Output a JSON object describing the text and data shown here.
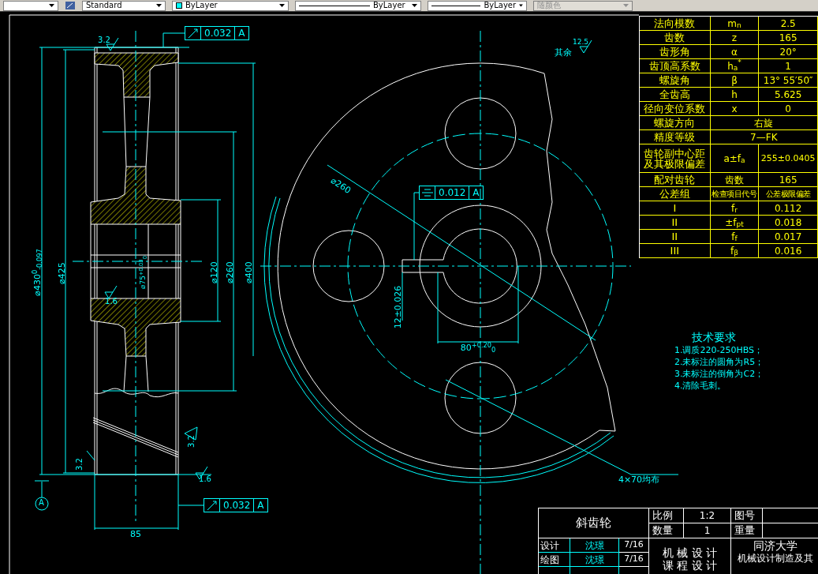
{
  "toolbar": {
    "dropdowns": [
      {
        "kind": "text",
        "text": "Standard",
        "disabled": false
      },
      {
        "kind": "color",
        "text": "ByLayer",
        "disabled": false
      },
      {
        "kind": "line",
        "text": "ByLayer",
        "disabled": false
      },
      {
        "kind": "line",
        "text": "ByLayer",
        "disabled": false
      },
      {
        "kind": "text",
        "text": "随颜色",
        "disabled": true
      }
    ]
  },
  "section_view": {
    "labels": [
      "3.2",
      "⌀430$^{0}$$_{-0.097}$",
      "⌀425",
      "⌀75$^{+0.03}$$_{0}$",
      "⌀120",
      "⌀260",
      "⌀400",
      "1.6",
      "3.2",
      "3.2",
      "1.6",
      "85"
    ],
    "tolerance_frames": [
      {
        "kind": "runout",
        "value": "0.032",
        "datum": "A"
      },
      {
        "kind": "runout",
        "value": "0.032",
        "datum": "A"
      }
    ],
    "datum": "A"
  },
  "front_view": {
    "labels": [
      "其余",
      "12.5",
      "⌀260",
      "12±0.026",
      "80$^{+0.20}$$_{0}$",
      "4×70均布"
    ],
    "tolerance_frames": [
      {
        "kind": "symmetry",
        "value": "0.012",
        "datum": "A"
      }
    ]
  },
  "parameter_table": {
    "rows": [
      {
        "kind": "param",
        "name": "法向模数",
        "symbol": "m$_{n}$",
        "value": "2.5"
      },
      {
        "kind": "param",
        "name": "齿数",
        "symbol": "z",
        "value": "165"
      },
      {
        "kind": "param",
        "name": "齿形角",
        "symbol": "α",
        "value": "20°"
      },
      {
        "kind": "param",
        "name": "齿顶高系数",
        "symbol": "h$_{a}$$^{*}$",
        "value": "1"
      },
      {
        "kind": "param",
        "name": "螺旋角",
        "symbol": "β",
        "value": "13° 55′50″"
      },
      {
        "kind": "param",
        "name": "全齿高",
        "symbol": "h",
        "value": "5.625"
      },
      {
        "kind": "param",
        "name": "径向变位系数",
        "symbol": "x",
        "value": "0"
      },
      {
        "kind": "merged",
        "name": "螺旋方向",
        "value": "右旋"
      },
      {
        "kind": "merged",
        "name": "精度等级",
        "value": "7—FK"
      },
      {
        "kind": "tall",
        "name": "齿轮副中心距及其极限偏差",
        "symbol": "a±f$_{a}$",
        "value": "255±0.0405"
      },
      {
        "kind": "param",
        "name": "配对齿轮",
        "symbol": "齿数",
        "value": "165"
      },
      {
        "kind": "header",
        "name": "公差组",
        "symbol": "检查项目代号",
        "value": "公差极限偏差"
      },
      {
        "kind": "param",
        "name": "I",
        "symbol": "f$_{r}$",
        "value": "0.112"
      },
      {
        "kind": "param",
        "name": "II",
        "symbol": "±f$_{pt}$",
        "value": "0.018"
      },
      {
        "kind": "param",
        "name": "II",
        "symbol": "f$_{f}$",
        "value": "0.017"
      },
      {
        "kind": "param",
        "name": "III",
        "symbol": "f$_{β}$",
        "value": "0.016"
      }
    ]
  },
  "tech_requirements": {
    "title": "技术要求",
    "items": [
      "1.调质220-250HBS；",
      "2.未标注的圆角为R5；",
      "3.未标注的倒角为C2；",
      "4.清除毛刺。"
    ]
  },
  "title_block": {
    "part_name": "斜齿轮",
    "scale_label": "比例",
    "scale": "1:2",
    "drawing_no_label": "图号",
    "qty_label": "数量",
    "qty": "1",
    "weight_label": "重量",
    "signatures": [
      {
        "role": "设计",
        "name": "沈璟",
        "date": "7/16"
      },
      {
        "role": "绘图",
        "name": "沈璟",
        "date": "7/16"
      }
    ],
    "course": [
      "机 械 设 计",
      "课 程 设 计"
    ],
    "school": "同济大学",
    "major": "机械设计制造及其"
  }
}
